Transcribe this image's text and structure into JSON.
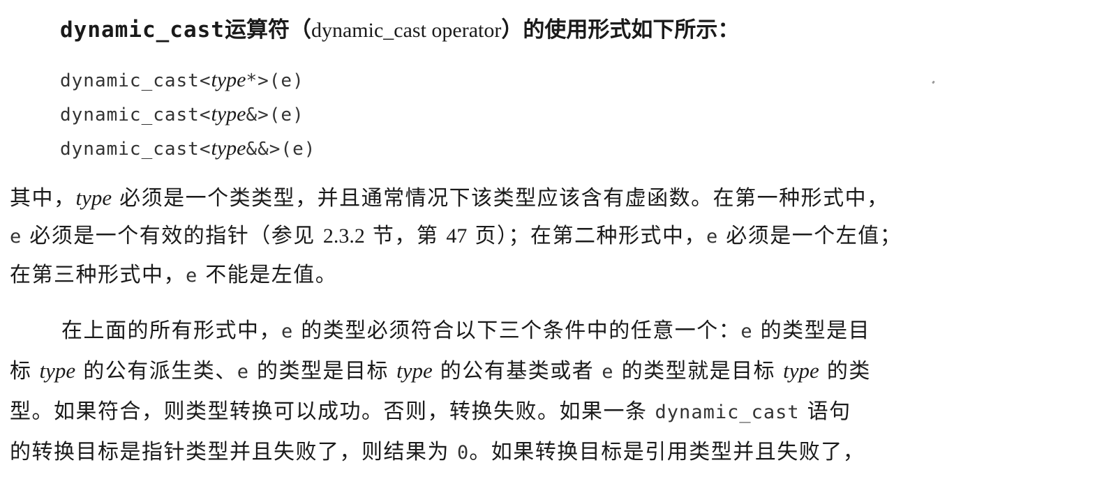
{
  "heading": {
    "keyword": "dynamic_cast",
    "label_cn": "运算符",
    "paren_open": "（",
    "label_en": "dynamic_cast operator",
    "paren_close": "）",
    "suffix": "的使用形式如下所示："
  },
  "code_forms": [
    {
      "prefix": "dynamic_cast<",
      "type_word": "type",
      "suffix": "*>(e)"
    },
    {
      "prefix": "dynamic_cast<",
      "type_word": "type",
      "suffix": "&>(e)"
    },
    {
      "prefix": "dynamic_cast<",
      "type_word": "type",
      "suffix": "&&>(e)"
    }
  ],
  "paragraph1": {
    "l1_a": "其中，",
    "l1_type": "type",
    "l1_b": " 必须是一个类类型，并且通常情况下该类型应该含有虚函数。在第一种形式中，",
    "l2_e1": "e",
    "l2_a": " 必须是一个有效的指针（参见 ",
    "l2_sec": "2.3.2",
    "l2_b": " 节，第 ",
    "l2_page": "47",
    "l2_c": " 页）；在第二种形式中，",
    "l2_e2": "e",
    "l2_d": " 必须是一个左值；",
    "l3_a": "在第三种形式中，",
    "l3_e": "e",
    "l3_b": " 不能是左值。"
  },
  "paragraph2": {
    "l1_a": "在上面的所有形式中，",
    "l1_e1": "e",
    "l1_b": " 的类型必须符合以下三个条件中的任意一个：",
    "l1_e2": "e",
    "l1_c": " 的类型是目",
    "l2_a": "标 ",
    "l2_type1": "type",
    "l2_b": " 的公有派生类、",
    "l2_e1": "e",
    "l2_c": " 的类型是目标 ",
    "l2_type2": "type",
    "l2_d": " 的公有基类或者 ",
    "l2_e2": "e",
    "l2_e": " 的类型就是目标 ",
    "l2_type3": "type",
    "l2_f": " 的类",
    "l3_a": "型。如果符合，则类型转换可以成功。否则，转换失败。如果一条 ",
    "l3_code": "dynamic_cast",
    "l3_b": " 语句",
    "l4_a": "的转换目标是指针类型并且失败了，则结果为 ",
    "l4_zero": "0",
    "l4_b": "。如果转换目标是引用类型并且失败了，"
  }
}
